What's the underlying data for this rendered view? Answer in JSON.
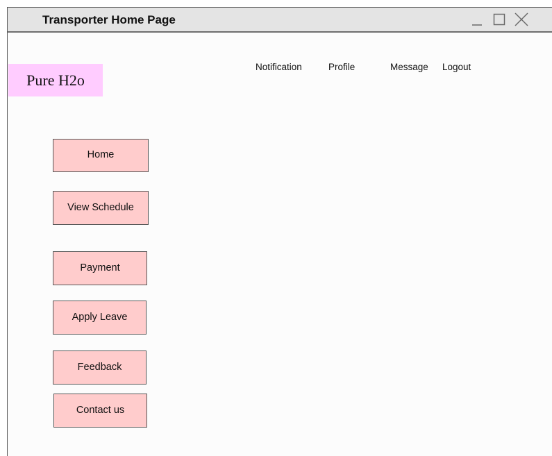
{
  "window": {
    "title": "Transporter Home Page",
    "controls": {
      "minimize": "minimize-icon",
      "maximize": "maximize-icon",
      "close": "close-icon"
    }
  },
  "logo": {
    "text": "Pure H2o",
    "background": "#ffccff"
  },
  "topnav": {
    "notification": "Notification",
    "profile": "Profile",
    "message": "Message",
    "logout": "Logout"
  },
  "sidebar": {
    "button_color": "#ffcccc",
    "items": [
      {
        "label": "Home"
      },
      {
        "label": "View Schedule"
      },
      {
        "label": "Payment"
      },
      {
        "label": "Apply Leave"
      },
      {
        "label": "Feedback"
      },
      {
        "label": "Contact us"
      }
    ]
  }
}
